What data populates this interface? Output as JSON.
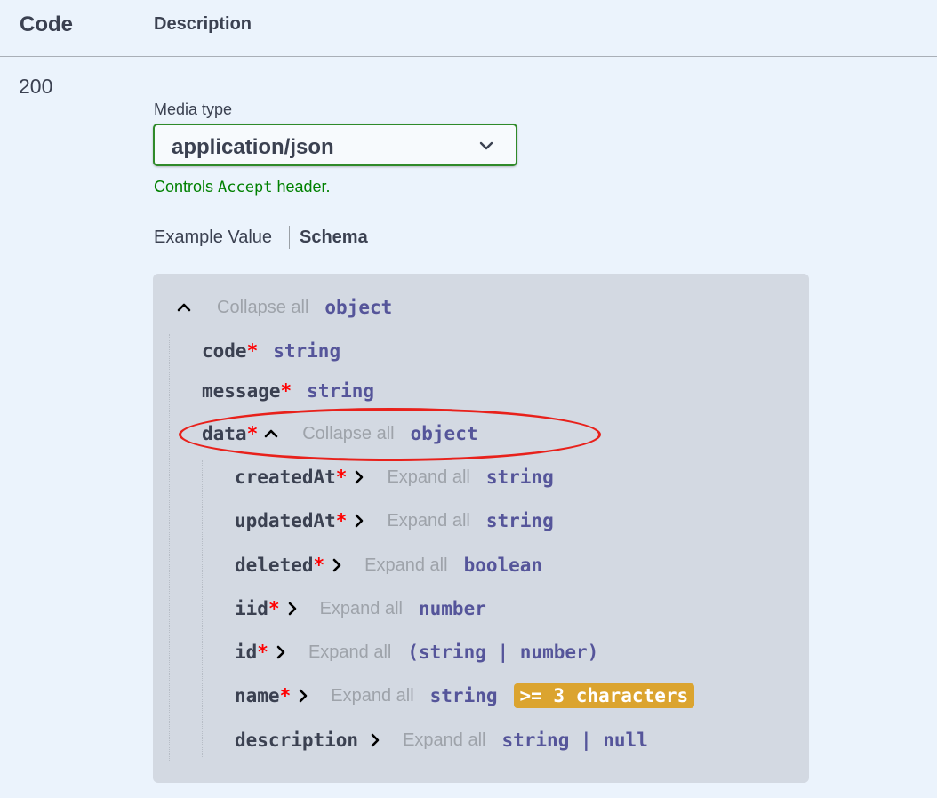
{
  "table_header": {
    "code": "Code",
    "description": "Description"
  },
  "response": {
    "code": "200",
    "media_type_label": "Media type",
    "media_type_value": "application/json",
    "controls_prefix": "Controls ",
    "controls_code": "Accept",
    "controls_suffix": " header."
  },
  "tabs": {
    "example_value": "Example Value",
    "schema": "Schema"
  },
  "schema": {
    "root": {
      "toggle_label": "Collapse all",
      "type": "object"
    },
    "fields": [
      {
        "name": "code",
        "required": "*",
        "type": "string"
      },
      {
        "name": "message",
        "required": "*",
        "type": "string"
      }
    ],
    "data_field": {
      "name": "data",
      "required": "*",
      "toggle_label": "Collapse all",
      "type": "object",
      "children": [
        {
          "name": "createdAt",
          "required": "*",
          "toggle_label": "Expand all",
          "type": "string"
        },
        {
          "name": "updatedAt",
          "required": "*",
          "toggle_label": "Expand all",
          "type": "string"
        },
        {
          "name": "deleted",
          "required": "*",
          "toggle_label": "Expand all",
          "type": "boolean"
        },
        {
          "name": "iid",
          "required": "*",
          "toggle_label": "Expand all",
          "type": "number"
        },
        {
          "name": "id",
          "required": "*",
          "toggle_label": "Expand all",
          "type": "(string | number)"
        },
        {
          "name": "name",
          "required": "*",
          "toggle_label": "Expand all",
          "type": "string",
          "badge": ">= 3 characters"
        },
        {
          "name": "description",
          "required": "",
          "toggle_label": "Expand all",
          "type": "string | null"
        }
      ]
    }
  },
  "icons": {
    "select_chevron": "chevron-down-icon",
    "collapse": "chevron-up-icon",
    "expand": "chevron-right-icon"
  },
  "colors": {
    "background": "#ebf3fc",
    "schema_panel": "#d3d9e2",
    "select_border": "#2f8a2a",
    "controls_note": "#008000",
    "required_star": "#ff0000",
    "type_text": "#55559a",
    "toggle_text": "#9ea3aa",
    "badge": "#dba42f",
    "highlight": "#e8211b"
  }
}
